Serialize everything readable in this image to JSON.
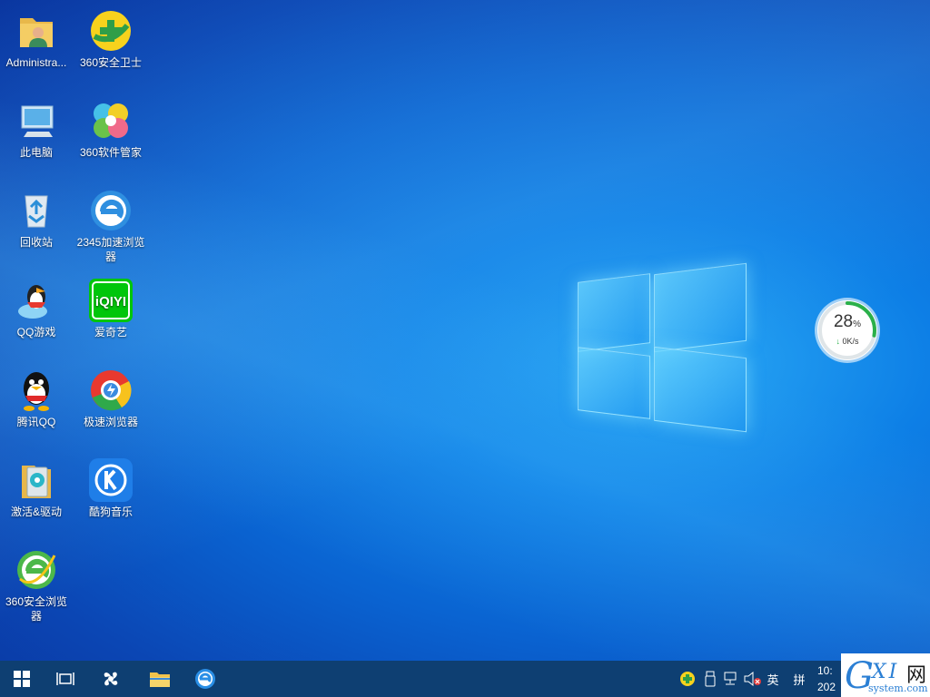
{
  "desktop": {
    "icons": [
      {
        "label": "Administra...",
        "icon": "user-folder-icon"
      },
      {
        "label": "360安全卫士",
        "icon": "360-security-icon"
      },
      {
        "label": "此电脑",
        "icon": "computer-icon"
      },
      {
        "label": "360软件管家",
        "icon": "360-software-manager-icon"
      },
      {
        "label": "回收站",
        "icon": "recycle-bin-icon"
      },
      {
        "label": "2345加速浏览器",
        "icon": "2345-browser-icon"
      },
      {
        "label": "QQ游戏",
        "icon": "qq-games-icon"
      },
      {
        "label": "爱奇艺",
        "icon": "iqiyi-icon"
      },
      {
        "label": "腾讯QQ",
        "icon": "qq-icon"
      },
      {
        "label": "极速浏览器",
        "icon": "speed-browser-icon"
      },
      {
        "label": "激活&驱动",
        "icon": "activation-driver-icon"
      },
      {
        "label": "酷狗音乐",
        "icon": "kugou-music-icon"
      },
      {
        "label": "360安全浏览器",
        "icon": "360-browser-icon"
      }
    ]
  },
  "speedball": {
    "percent": "28",
    "percent_unit": "%",
    "arrow": "↓",
    "rate": "0K/s",
    "progress": 0.28
  },
  "taskbar": {
    "pinned": [
      "start-icon",
      "task-view-icon",
      "fan-app-icon",
      "file-explorer-icon",
      "edge-browser-icon"
    ],
    "tray": {
      "ime_lang": "英",
      "ime_mode": "拼"
    },
    "clock_time": "10:",
    "clock_date": "202"
  },
  "watermark": {
    "g": "G",
    "xi": "XI",
    "wang": "网",
    "domain": "system.com"
  },
  "colors": {
    "taskbar": "#0e3f72",
    "accent": "#0a63d1",
    "speed_green": "#2ab04a"
  }
}
